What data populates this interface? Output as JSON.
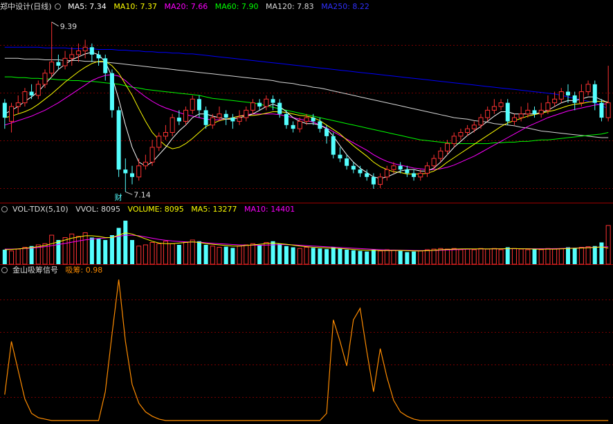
{
  "main": {
    "title": "郑中设计(日线)",
    "ma": [
      {
        "label": "MA5: 7.34",
        "color": "#ffffff"
      },
      {
        "label": "MA10: 7.37",
        "color": "#ffff00"
      },
      {
        "label": "MA20: 7.66",
        "color": "#ff00ff"
      },
      {
        "label": "MA60: 7.90",
        "color": "#00ff00"
      },
      {
        "label": "MA120: 7.83",
        "color": "#d8d8d8"
      },
      {
        "label": "MA250: 8.22",
        "color": "#0000ff"
      }
    ],
    "high_label": "9.39",
    "low_label": "7.14",
    "marker": "财"
  },
  "vol": {
    "title": "VOL-TDX(5,10)",
    "vvol": "VVOL: 8095",
    "volume": "VOLUME: 8095",
    "ma5": "MA5: 13277",
    "ma10": "MA10: 14401"
  },
  "sig": {
    "title": "金山吸筹信号",
    "label": "吸筹: 0.98"
  },
  "colors": {
    "up": "#ff3232",
    "down": "#54ffff",
    "grid": "#7a0000",
    "signal": "#ff8c00"
  },
  "chart_data": {
    "type": "candlestick",
    "price_range": [
      7.0,
      9.5
    ],
    "candles": [
      [
        8.3,
        8.1,
        8.35,
        7.95
      ],
      [
        8.05,
        8.25,
        8.3,
        7.9
      ],
      [
        8.25,
        8.3,
        8.4,
        8.15
      ],
      [
        8.3,
        8.45,
        8.5,
        8.25
      ],
      [
        8.45,
        8.4,
        8.55,
        8.35
      ],
      [
        8.4,
        8.55,
        8.6,
        8.35
      ],
      [
        8.55,
        8.7,
        8.75,
        8.5
      ],
      [
        8.7,
        8.85,
        9.39,
        8.65
      ],
      [
        8.85,
        8.8,
        8.95,
        8.75
      ],
      [
        8.8,
        8.9,
        9.0,
        8.75
      ],
      [
        8.9,
        8.95,
        9.05,
        8.8
      ],
      [
        8.95,
        9.0,
        9.1,
        8.85
      ],
      [
        9.0,
        9.05,
        9.15,
        8.9
      ],
      [
        9.05,
        8.95,
        9.1,
        8.85
      ],
      [
        8.95,
        8.9,
        9.0,
        8.8
      ],
      [
        8.9,
        8.7,
        8.95,
        8.6
      ],
      [
        8.7,
        8.2,
        8.75,
        8.1
      ],
      [
        8.2,
        7.4,
        8.25,
        7.3
      ],
      [
        7.4,
        7.35,
        7.55,
        7.1
      ],
      [
        7.35,
        7.3,
        7.45,
        7.2
      ],
      [
        7.3,
        7.45,
        7.55,
        7.25
      ],
      [
        7.45,
        7.5,
        7.6,
        7.4
      ],
      [
        7.5,
        7.7,
        7.8,
        7.45
      ],
      [
        7.7,
        7.85,
        7.9,
        7.65
      ],
      [
        7.85,
        7.9,
        8.0,
        7.8
      ],
      [
        7.9,
        8.1,
        8.15,
        7.85
      ],
      [
        8.1,
        8.05,
        8.2,
        8.0
      ],
      [
        8.05,
        8.2,
        8.25,
        8.0
      ],
      [
        8.2,
        8.35,
        8.4,
        8.15
      ],
      [
        8.35,
        8.2,
        8.4,
        8.1
      ],
      [
        8.2,
        8.0,
        8.25,
        7.95
      ],
      [
        8.0,
        8.1,
        8.15,
        7.95
      ],
      [
        8.1,
        8.15,
        8.25,
        8.05
      ],
      [
        8.15,
        8.1,
        8.2,
        8.0
      ],
      [
        8.1,
        8.05,
        8.15,
        7.95
      ],
      [
        8.05,
        8.1,
        8.2,
        8.0
      ],
      [
        8.1,
        8.2,
        8.25,
        8.05
      ],
      [
        8.2,
        8.3,
        8.35,
        8.15
      ],
      [
        8.3,
        8.25,
        8.35,
        8.2
      ],
      [
        8.25,
        8.35,
        8.4,
        8.2
      ],
      [
        8.35,
        8.3,
        8.4,
        8.2
      ],
      [
        8.3,
        8.15,
        8.35,
        8.1
      ],
      [
        8.15,
        8.0,
        8.2,
        7.95
      ],
      [
        8.0,
        7.95,
        8.05,
        7.9
      ],
      [
        7.95,
        8.05,
        8.1,
        7.9
      ],
      [
        8.05,
        8.1,
        8.15,
        8.0
      ],
      [
        8.1,
        8.05,
        8.15,
        8.0
      ],
      [
        8.05,
        7.95,
        8.1,
        7.9
      ],
      [
        7.95,
        7.85,
        8.0,
        7.75
      ],
      [
        7.85,
        7.6,
        7.9,
        7.55
      ],
      [
        7.6,
        7.55,
        7.7,
        7.5
      ],
      [
        7.55,
        7.45,
        7.6,
        7.4
      ],
      [
        7.45,
        7.4,
        7.5,
        7.35
      ],
      [
        7.4,
        7.35,
        7.45,
        7.3
      ],
      [
        7.35,
        7.3,
        7.4,
        7.25
      ],
      [
        7.3,
        7.2,
        7.35,
        7.14
      ],
      [
        7.2,
        7.3,
        7.35,
        7.15
      ],
      [
        7.3,
        7.4,
        7.45,
        7.25
      ],
      [
        7.4,
        7.45,
        7.5,
        7.35
      ],
      [
        7.45,
        7.4,
        7.5,
        7.35
      ],
      [
        7.4,
        7.35,
        7.45,
        7.3
      ],
      [
        7.35,
        7.3,
        7.4,
        7.25
      ],
      [
        7.3,
        7.35,
        7.4,
        7.25
      ],
      [
        7.35,
        7.45,
        7.5,
        7.3
      ],
      [
        7.45,
        7.55,
        7.6,
        7.4
      ],
      [
        7.55,
        7.65,
        7.7,
        7.5
      ],
      [
        7.65,
        7.75,
        7.8,
        7.6
      ],
      [
        7.75,
        7.85,
        7.9,
        7.7
      ],
      [
        7.85,
        7.9,
        7.95,
        7.8
      ],
      [
        7.9,
        7.95,
        8.0,
        7.85
      ],
      [
        7.95,
        8.0,
        8.05,
        7.9
      ],
      [
        8.0,
        8.1,
        8.15,
        7.95
      ],
      [
        8.1,
        8.2,
        8.25,
        8.05
      ],
      [
        8.2,
        8.25,
        8.35,
        8.15
      ],
      [
        8.25,
        8.3,
        8.35,
        8.2
      ],
      [
        8.3,
        8.05,
        8.35,
        8.0
      ],
      [
        8.05,
        8.1,
        8.15,
        8.0
      ],
      [
        8.1,
        8.15,
        8.25,
        8.05
      ],
      [
        8.15,
        8.2,
        8.3,
        8.1
      ],
      [
        8.2,
        8.15,
        8.25,
        8.1
      ],
      [
        8.15,
        8.2,
        8.3,
        8.1
      ],
      [
        8.2,
        8.3,
        8.4,
        8.15
      ],
      [
        8.3,
        8.35,
        8.45,
        8.25
      ],
      [
        8.35,
        8.45,
        8.5,
        8.3
      ],
      [
        8.45,
        8.4,
        8.55,
        8.3
      ],
      [
        8.4,
        8.3,
        8.45,
        8.2
      ],
      [
        8.3,
        8.45,
        8.55,
        8.25
      ],
      [
        8.45,
        8.55,
        8.6,
        8.4
      ],
      [
        8.55,
        8.3,
        8.6,
        8.2
      ],
      [
        8.3,
        8.1,
        8.35,
        8.05
      ],
      [
        8.1,
        8.3,
        8.8,
        8.05
      ]
    ],
    "ma": {
      "MA5": [
        8.15,
        8.2,
        8.25,
        8.32,
        8.38,
        8.45,
        8.55,
        8.65,
        8.75,
        8.82,
        8.88,
        8.92,
        8.96,
        8.98,
        8.95,
        8.85,
        8.65,
        8.35,
        8.0,
        7.7,
        7.5,
        7.45,
        7.5,
        7.6,
        7.7,
        7.82,
        7.92,
        8.0,
        8.1,
        8.15,
        8.15,
        8.12,
        8.1,
        8.08,
        8.08,
        8.1,
        8.12,
        8.15,
        8.2,
        8.25,
        8.28,
        8.25,
        8.18,
        8.1,
        8.05,
        8.02,
        8.02,
        8.0,
        7.95,
        7.85,
        7.72,
        7.6,
        7.5,
        7.42,
        7.36,
        7.3,
        7.28,
        7.3,
        7.34,
        7.38,
        7.4,
        7.4,
        7.38,
        7.38,
        7.42,
        7.5,
        7.6,
        7.7,
        7.78,
        7.86,
        7.92,
        7.98,
        8.05,
        8.12,
        8.18,
        8.18,
        8.15,
        8.15,
        8.15,
        8.15,
        8.17,
        8.2,
        8.25,
        8.3,
        8.33,
        8.33,
        8.35,
        8.38,
        8.38,
        8.34,
        8.3
      ],
      "MA10": [
        8.1,
        8.12,
        8.15,
        8.18,
        8.22,
        8.28,
        8.35,
        8.42,
        8.5,
        8.58,
        8.65,
        8.72,
        8.78,
        8.83,
        8.86,
        8.86,
        8.8,
        8.7,
        8.55,
        8.4,
        8.22,
        8.05,
        7.9,
        7.8,
        7.72,
        7.68,
        7.7,
        7.75,
        7.82,
        7.9,
        7.98,
        8.02,
        8.06,
        8.08,
        8.1,
        8.12,
        8.13,
        8.13,
        8.14,
        8.16,
        8.18,
        8.18,
        8.17,
        8.15,
        8.13,
        8.12,
        8.1,
        8.06,
        8.0,
        7.94,
        7.88,
        7.8,
        7.72,
        7.65,
        7.58,
        7.5,
        7.44,
        7.4,
        7.37,
        7.36,
        7.34,
        7.34,
        7.34,
        7.35,
        7.38,
        7.43,
        7.5,
        7.56,
        7.62,
        7.68,
        7.74,
        7.8,
        7.86,
        7.92,
        7.98,
        8.03,
        8.06,
        8.09,
        8.12,
        8.14,
        8.16,
        8.18,
        8.2,
        8.23,
        8.26,
        8.28,
        8.29,
        8.31,
        8.32,
        8.32,
        8.31
      ],
      "MA20": [
        8.0,
        8.03,
        8.06,
        8.09,
        8.12,
        8.16,
        8.2,
        8.25,
        8.3,
        8.36,
        8.42,
        8.48,
        8.54,
        8.6,
        8.64,
        8.67,
        8.68,
        8.66,
        8.6,
        8.52,
        8.45,
        8.38,
        8.32,
        8.27,
        8.23,
        8.2,
        8.17,
        8.14,
        8.12,
        8.1,
        8.08,
        8.07,
        8.07,
        8.08,
        8.1,
        8.12,
        8.14,
        8.15,
        8.15,
        8.15,
        8.15,
        8.14,
        8.12,
        8.1,
        8.08,
        8.06,
        8.04,
        8.0,
        7.96,
        7.91,
        7.86,
        7.81,
        7.76,
        7.71,
        7.66,
        7.6,
        7.55,
        7.51,
        7.48,
        7.46,
        7.44,
        7.42,
        7.41,
        7.4,
        7.4,
        7.41,
        7.43,
        7.46,
        7.5,
        7.54,
        7.58,
        7.63,
        7.68,
        7.73,
        7.78,
        7.83,
        7.88,
        7.93,
        7.98,
        8.02,
        8.06,
        8.1,
        8.13,
        8.16,
        8.19,
        8.21,
        8.23,
        8.25,
        8.27,
        8.28,
        8.29
      ],
      "MA60": [
        8.65,
        8.65,
        8.64,
        8.64,
        8.63,
        8.63,
        8.62,
        8.62,
        8.61,
        8.61,
        8.6,
        8.6,
        8.59,
        8.59,
        8.58,
        8.57,
        8.56,
        8.55,
        8.53,
        8.51,
        8.5,
        8.48,
        8.47,
        8.46,
        8.45,
        8.44,
        8.43,
        8.42,
        8.41,
        8.4,
        8.38,
        8.36,
        8.35,
        8.34,
        8.33,
        8.32,
        8.31,
        8.3,
        8.28,
        8.26,
        8.24,
        8.22,
        8.2,
        8.18,
        8.16,
        8.14,
        8.12,
        8.1,
        8.08,
        8.06,
        8.04,
        8.02,
        8.0,
        7.98,
        7.96,
        7.94,
        7.92,
        7.9,
        7.88,
        7.86,
        7.84,
        7.82,
        7.8,
        7.79,
        7.78,
        7.77,
        7.76,
        7.75,
        7.75,
        7.75,
        7.75,
        7.75,
        7.75,
        7.76,
        7.76,
        7.77,
        7.77,
        7.78,
        7.78,
        7.79,
        7.8,
        7.8,
        7.81,
        7.82,
        7.83,
        7.84,
        7.85,
        7.86,
        7.87,
        7.88,
        7.9
      ],
      "MA120": [
        8.9,
        8.9,
        8.9,
        8.89,
        8.89,
        8.89,
        8.88,
        8.88,
        8.88,
        8.87,
        8.87,
        8.87,
        8.86,
        8.86,
        8.85,
        8.85,
        8.84,
        8.83,
        8.82,
        8.81,
        8.8,
        8.79,
        8.78,
        8.77,
        8.76,
        8.75,
        8.74,
        8.73,
        8.72,
        8.71,
        8.7,
        8.69,
        8.68,
        8.67,
        8.66,
        8.65,
        8.64,
        8.63,
        8.62,
        8.61,
        8.6,
        8.58,
        8.57,
        8.56,
        8.54,
        8.53,
        8.51,
        8.5,
        8.48,
        8.46,
        8.44,
        8.42,
        8.4,
        8.38,
        8.36,
        8.34,
        8.32,
        8.3,
        8.28,
        8.26,
        8.24,
        8.22,
        8.2,
        8.18,
        8.16,
        8.14,
        8.12,
        8.1,
        8.09,
        8.08,
        8.06,
        8.05,
        8.04,
        8.02,
        8.01,
        8.0,
        7.99,
        7.97,
        7.96,
        7.94,
        7.92,
        7.91,
        7.9,
        7.89,
        7.88,
        7.87,
        7.86,
        7.85,
        7.84,
        7.83,
        7.83
      ],
      "MA250": [
        9.05,
        9.05,
        9.05,
        9.05,
        9.05,
        9.05,
        9.04,
        9.04,
        9.04,
        9.04,
        9.03,
        9.03,
        9.03,
        9.03,
        9.02,
        9.02,
        9.02,
        9.01,
        9.01,
        9.0,
        9.0,
        8.99,
        8.99,
        8.98,
        8.98,
        8.97,
        8.97,
        8.96,
        8.96,
        8.95,
        8.94,
        8.93,
        8.92,
        8.91,
        8.9,
        8.89,
        8.88,
        8.87,
        8.86,
        8.85,
        8.84,
        8.83,
        8.82,
        8.81,
        8.8,
        8.79,
        8.78,
        8.77,
        8.76,
        8.75,
        8.74,
        8.73,
        8.72,
        8.71,
        8.7,
        8.69,
        8.68,
        8.67,
        8.66,
        8.65,
        8.64,
        8.63,
        8.62,
        8.61,
        8.6,
        8.59,
        8.58,
        8.57,
        8.56,
        8.55,
        8.54,
        8.53,
        8.52,
        8.51,
        8.5,
        8.49,
        8.48,
        8.47,
        8.46,
        8.45,
        8.44,
        8.43,
        8.42,
        8.4,
        8.38,
        8.36,
        8.34,
        8.32,
        8.3,
        8.26,
        8.22
      ]
    },
    "volume_range": [
      0,
      40000
    ],
    "volume": [
      12000,
      11000,
      12500,
      14000,
      15000,
      16000,
      17000,
      24000,
      20000,
      22000,
      25000,
      23000,
      26000,
      22000,
      21000,
      20000,
      24000,
      30000,
      36000,
      20000,
      15000,
      16000,
      18000,
      17000,
      19000,
      17000,
      16000,
      18000,
      20000,
      19000,
      16000,
      15000,
      14000,
      14500,
      13500,
      15000,
      16000,
      17000,
      16000,
      18000,
      19000,
      17000,
      15000,
      14000,
      13000,
      14000,
      13500,
      13000,
      12500,
      14000,
      13000,
      12000,
      11500,
      11000,
      10500,
      12000,
      11000,
      12000,
      11500,
      11000,
      10000,
      10500,
      11000,
      12000,
      12500,
      13000,
      12500,
      13000,
      12000,
      12500,
      12000,
      13000,
      12500,
      13000,
      12000,
      14000,
      13000,
      12500,
      12000,
      12500,
      12000,
      13000,
      12500,
      13000,
      14000,
      13500,
      14000,
      14500,
      15000,
      18000,
      32000
    ],
    "vol_ma5": [
      12000,
      12200,
      12600,
      13200,
      13800,
      14500,
      15500,
      17000,
      18500,
      20000,
      21500,
      22500,
      23500,
      23500,
      23000,
      22000,
      22000,
      24000,
      26000,
      25000,
      23000,
      21000,
      19000,
      17500,
      17000,
      17000,
      17500,
      18000,
      18500,
      18000,
      17000,
      16500,
      16000,
      15500,
      15000,
      15000,
      15500,
      16000,
      16500,
      17000,
      17500,
      17000,
      16500,
      15800,
      15000,
      14500,
      14000,
      13800,
      13500,
      13300,
      13000,
      12600,
      12200,
      11800,
      11500,
      11500,
      11300,
      11300,
      11400,
      11400,
      11200,
      11000,
      11000,
      11200,
      11500,
      12000,
      12200,
      12500,
      12600,
      12700,
      12600,
      12700,
      12600,
      12700,
      12700,
      12900,
      12900,
      12800,
      12700,
      12500,
      12400,
      12500,
      12500,
      12700,
      13000,
      13200,
      13400,
      13600,
      13900,
      14300,
      13277
    ],
    "vol_ma10": [
      12500,
      12500,
      12700,
      13000,
      13400,
      13900,
      14500,
      15400,
      16300,
      17200,
      18200,
      19200,
      20100,
      20800,
      21300,
      21700,
      22200,
      23000,
      24000,
      24000,
      23500,
      22500,
      21500,
      20500,
      19800,
      19200,
      18800,
      18500,
      18300,
      18200,
      17800,
      17300,
      16900,
      16600,
      16300,
      16000,
      15800,
      15700,
      15700,
      15800,
      16000,
      16200,
      16200,
      16000,
      15700,
      15300,
      15000,
      14700,
      14400,
      14100,
      13800,
      13500,
      13200,
      12900,
      12600,
      12300,
      12000,
      11800,
      11700,
      11600,
      11500,
      11400,
      11300,
      11300,
      11400,
      11600,
      11800,
      12000,
      12200,
      12400,
      12500,
      12600,
      12600,
      12700,
      12700,
      12800,
      12800,
      12800,
      12800,
      12800,
      12800,
      12800,
      12900,
      13000,
      13200,
      13400,
      13600,
      13800,
      14000,
      14200,
      14401
    ],
    "signal_range": [
      0,
      1
    ],
    "signal": [
      0.18,
      0.55,
      0.35,
      0.15,
      0.05,
      0.02,
      0.01,
      0,
      0,
      0,
      0,
      0,
      0,
      0,
      0,
      0.2,
      0.6,
      0.98,
      0.55,
      0.25,
      0.12,
      0.06,
      0.03,
      0.01,
      0,
      0,
      0,
      0,
      0,
      0,
      0,
      0,
      0,
      0,
      0,
      0,
      0,
      0,
      0,
      0,
      0,
      0,
      0,
      0,
      0,
      0,
      0,
      0,
      0.05,
      0.7,
      0.55,
      0.38,
      0.7,
      0.78,
      0.48,
      0.2,
      0.5,
      0.3,
      0.14,
      0.06,
      0.03,
      0.01,
      0,
      0,
      0,
      0,
      0,
      0,
      0,
      0,
      0,
      0,
      0,
      0,
      0,
      0,
      0,
      0,
      0,
      0,
      0,
      0,
      0,
      0,
      0,
      0,
      0,
      0,
      0,
      0,
      0
    ]
  }
}
